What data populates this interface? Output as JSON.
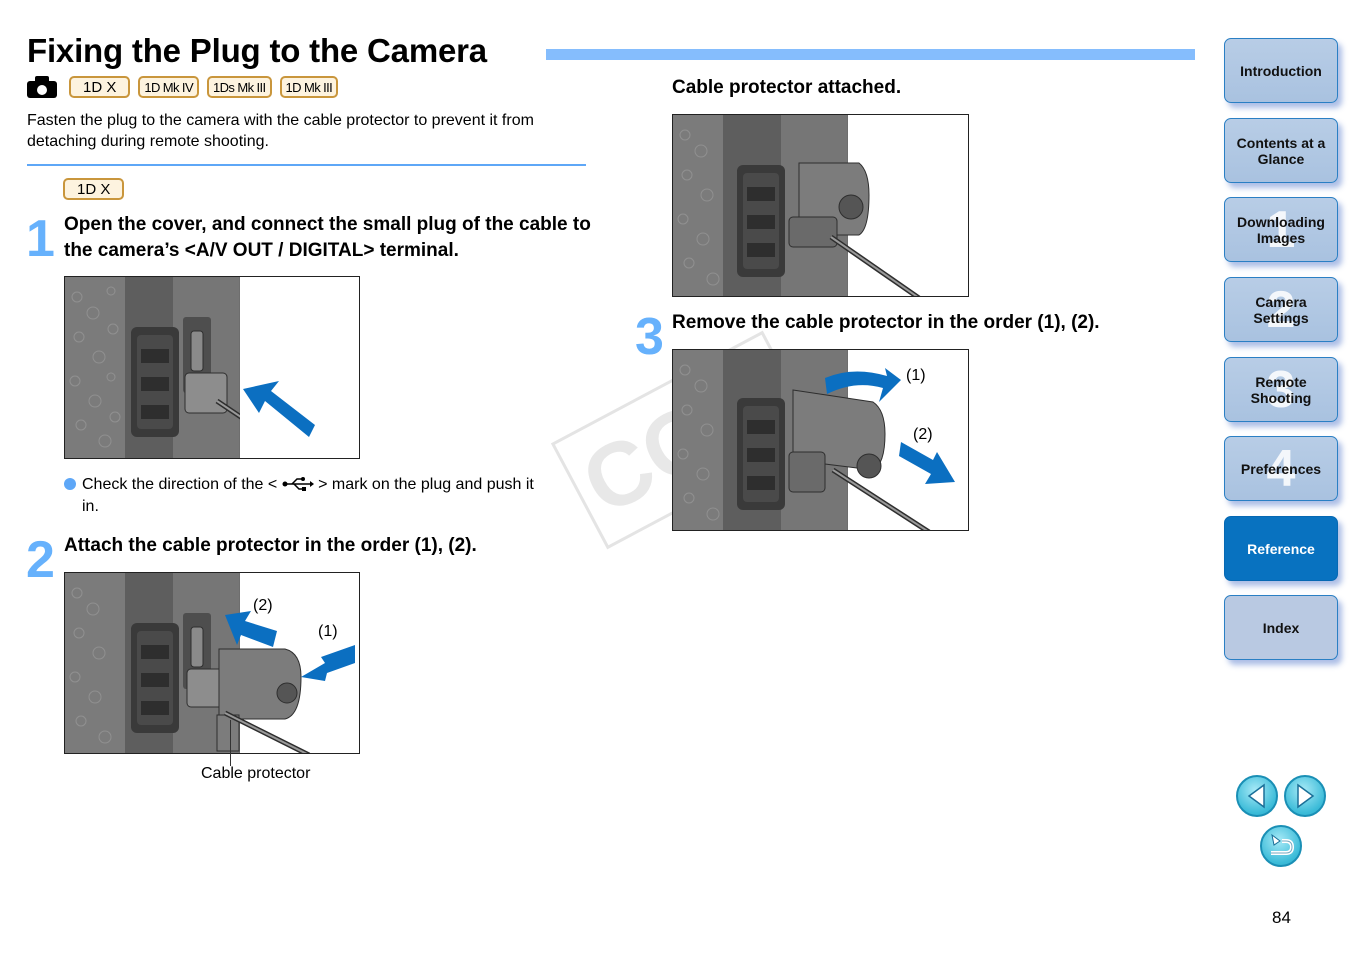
{
  "header": {
    "title": "Fixing the Plug to the Camera",
    "models": [
      "1D X",
      "1D Mk IV",
      "1Ds Mk III",
      "1D Mk III"
    ],
    "intro": "Fasten the plug to the camera with the cable protector to prevent it from detaching during remote shooting."
  },
  "section_badge": "1D X",
  "steps": [
    {
      "number": "1",
      "text": "Open the cover, and connect the small plug of the cable to the camera’s <A/V OUT / DIGITAL> terminal.",
      "note_before": "Check the direction of the <",
      "note_after": "> mark on the plug and push it",
      "note_cont": "in."
    },
    {
      "number": "2",
      "text": "Attach the cable protector in the order (1), (2).",
      "labels": [
        "(2)",
        "(1)"
      ],
      "caption": "Cable protector"
    },
    {
      "result_heading": "Cable protector attached."
    },
    {
      "number": "3",
      "text": "Remove the cable protector in the order (1), (2).",
      "labels": [
        "(1)",
        "(2)"
      ]
    }
  ],
  "watermark": "COPY",
  "sidebar": {
    "items": [
      {
        "label": "Introduction",
        "ghost": ""
      },
      {
        "label": "Contents at a Glance",
        "ghost": ""
      },
      {
        "label": "Downloading Images",
        "ghost": "1"
      },
      {
        "label": "Camera Settings",
        "ghost": "2"
      },
      {
        "label": "Remote Shooting",
        "ghost": "3"
      },
      {
        "label": "Preferences",
        "ghost": "4"
      },
      {
        "label": "Reference",
        "ghost": ""
      },
      {
        "label": "Index",
        "ghost": ""
      }
    ],
    "active": "Reference"
  },
  "footer": {
    "page_number": "84"
  },
  "colors": {
    "accent_blue": "#66b1fc",
    "title_bar": "#85bdfd",
    "badge_border": "#c9963c",
    "nav_active": "#0872c0",
    "arrow_blue": "#0b6fc1"
  }
}
